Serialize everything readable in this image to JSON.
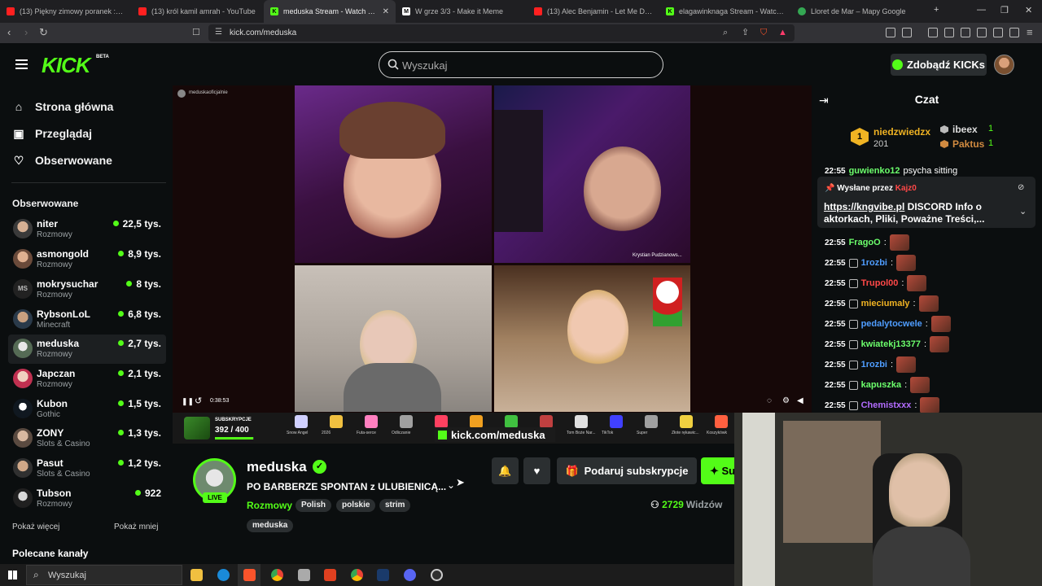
{
  "browser": {
    "tabs": [
      {
        "title": "(13) Piękny zimowy poranek :) - YouT",
        "color": "#ff2020"
      },
      {
        "title": "(13) król kamil amrah - YouTube",
        "color": "#ff2020"
      },
      {
        "title": "meduska Stream - Watch Live",
        "color": "#53fc18"
      },
      {
        "title": "W grze 3/3 - Make it Meme",
        "color": "#ffffff"
      },
      {
        "title": "(13) Alec Benjamin - Let Me Down S",
        "color": "#ff2020"
      },
      {
        "title": "elagawinknaga Stream - Watch L",
        "color": "#53fc18"
      },
      {
        "title": "Lloret de Mar – Mapy Google",
        "color": "#34a853"
      }
    ],
    "url": "kick.com/meduska"
  },
  "header": {
    "logo": "KICK",
    "beta": "BETA",
    "search_placeholder": "Wyszukaj",
    "get_kicks_label": "Zdobądź KICKs"
  },
  "sidebar": {
    "nav": [
      {
        "label": "Strona główna",
        "icon": "home-icon"
      },
      {
        "label": "Przeglądaj",
        "icon": "browse-icon"
      },
      {
        "label": "Obserwowane",
        "icon": "heart-icon"
      }
    ],
    "followed_title": "Obserwowane",
    "channels": [
      {
        "name": "niter",
        "category": "Rozmowy",
        "viewers": "22,5 tys."
      },
      {
        "name": "asmongold",
        "category": "Rozmowy",
        "viewers": "8,9 tys."
      },
      {
        "name": "mokrysuchar",
        "category": "Rozmowy",
        "viewers": "8 tys."
      },
      {
        "name": "RybsonLoL",
        "category": "Minecraft",
        "viewers": "6,8 tys."
      },
      {
        "name": "meduska",
        "category": "Rozmowy",
        "viewers": "2,7 tys."
      },
      {
        "name": "Japczan",
        "category": "Rozmowy",
        "viewers": "2,1 tys."
      },
      {
        "name": "Kubon",
        "category": "Gothic",
        "viewers": "1,5 tys."
      },
      {
        "name": "ZONY",
        "category": "Slots & Casino",
        "viewers": "1,3 tys."
      },
      {
        "name": "Pasut",
        "category": "Slots & Casino",
        "viewers": "1,2 tys."
      },
      {
        "name": "Tubson",
        "category": "Rozmowy",
        "viewers": "922"
      }
    ],
    "show_more": "Pokaż więcej",
    "show_less": "Pokaż mniej",
    "recommended_title": "Polecane kanały"
  },
  "video": {
    "time": "0:38:53",
    "overlay_url": "kick.com/meduska",
    "sub_goal_label": "SUBSKRYPCJE",
    "sub_goal_value": "392 / 400",
    "sub_goal_progress": 0.98,
    "tile_caption": "Krystian Pudzianows...",
    "stickers": [
      "Snow Angel",
      "2026",
      "Futa-serce",
      "Odliczanie",
      "",
      "",
      "",
      "",
      "Tom Boże Nar...",
      "TikTok",
      "Super",
      "Złote rękawic...",
      "Koszykówk"
    ]
  },
  "stream": {
    "channel": "meduska",
    "live_badge": "LIVE",
    "title": "PO BARBERZE SPONTAN z ULUBIENICĄ...",
    "category": "Rozmowy",
    "tags": [
      "Polish",
      "polskie",
      "strim",
      "meduska"
    ],
    "gift_label": "Podaruj subskrypcje",
    "subscribe_label": "Su",
    "viewers": "2729",
    "viewers_label": "Widzów"
  },
  "chat": {
    "title": "Czat",
    "leaderboard": {
      "first": {
        "rank": "1",
        "name": "niedzwiedzx",
        "count": "201"
      },
      "second": {
        "name": "ibeex",
        "count": "1"
      },
      "third": {
        "name": "Paktus",
        "count": "1"
      }
    },
    "partial_line": {
      "time": "22:55",
      "user": "guwienko12",
      "text": "psycha sitting"
    },
    "pinned": {
      "header": "Wysłane przez",
      "user": "Kajz0",
      "link": "https://kngvibe.pl",
      "text": " DISCORD Info o aktorkach, Pliki, Poważne Treści,..."
    },
    "messages": [
      {
        "time": "22:55",
        "user": "FragoO",
        "color": "#6cff6c"
      },
      {
        "time": "22:55",
        "user": "1rozbi",
        "color": "#4f9dff"
      },
      {
        "time": "22:55",
        "user": "Trupol00",
        "color": "#ff4848"
      },
      {
        "time": "22:55",
        "user": "mieciumaly",
        "color": "#f0b323"
      },
      {
        "time": "22:55",
        "user": "pedalytocwele",
        "color": "#4f9dff"
      },
      {
        "time": "22:55",
        "user": "kwiatekj13377",
        "color": "#6cff6c"
      },
      {
        "time": "22:55",
        "user": "1rozbi",
        "color": "#4f9dff"
      },
      {
        "time": "22:55",
        "user": "kapuszka",
        "color": "#6cff6c"
      },
      {
        "time": "22:55",
        "user": "Chemistxxx",
        "color": "#b36cff"
      }
    ]
  },
  "taskbar": {
    "search_placeholder": "Wyszukaj"
  }
}
